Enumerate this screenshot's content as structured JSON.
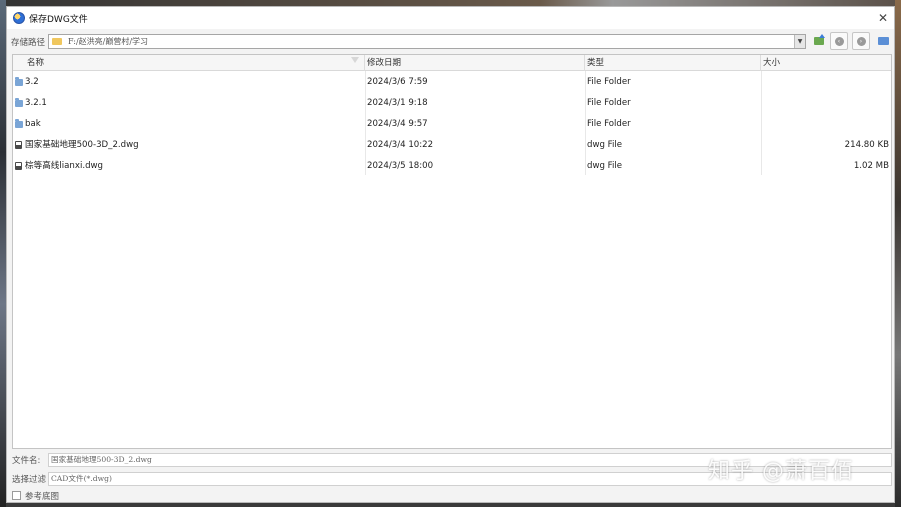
{
  "window": {
    "title": "保存DWG文件",
    "close_glyph": "✕"
  },
  "path": {
    "label": "存储路径",
    "value": "F:/赵洪亮/巅营村/学习"
  },
  "columns": {
    "name": "名称",
    "date": "修改日期",
    "type": "类型",
    "size": "大小"
  },
  "files": [
    {
      "name": "3.2",
      "date": "2024/3/6 7:59",
      "type": "File Folder",
      "size": "",
      "icon": "folder-icon"
    },
    {
      "name": "3.2.1",
      "date": "2024/3/1 9:18",
      "type": "File Folder",
      "size": "",
      "icon": "folder-icon"
    },
    {
      "name": "bak",
      "date": "2024/3/4 9:57",
      "type": "File Folder",
      "size": "",
      "icon": "folder-icon"
    },
    {
      "name": "国家基础地理500-3D_2.dwg",
      "date": "2024/3/4 10:22",
      "type": "dwg File",
      "size": "214.80 KB",
      "icon": "file-icon"
    },
    {
      "name": "棕等高线lianxi.dwg",
      "date": "2024/3/5 18:00",
      "type": "dwg File",
      "size": "1.02 MB",
      "icon": "file-icon"
    }
  ],
  "filename": {
    "label": "文件名:",
    "value": "国家基础地理500-3D_2.dwg"
  },
  "filter": {
    "label": "选择过滤",
    "value": "CAD文件(*.dwg)"
  },
  "reference": {
    "label": "参考底图",
    "checked": false
  },
  "watermark": "知乎 @萧百佰"
}
